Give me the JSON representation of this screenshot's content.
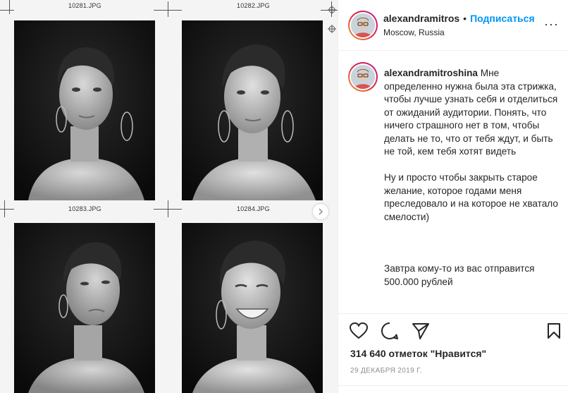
{
  "media": {
    "filenames": [
      "10281.JPG",
      "10282.JPG",
      "10283.JPG",
      "10284.JPG"
    ],
    "next_icon": "chevron-right-icon"
  },
  "post": {
    "header": {
      "username": "alexandramitros",
      "separator": "•",
      "follow_label": "Подписаться",
      "location": "Moscow, Russia",
      "more_icon": "more-options-icon",
      "more_glyph": "···"
    },
    "caption": {
      "username": "alexandramitroshina",
      "paragraph_1": "Мне определенно нужна была эта стрижка, чтобы лучше узнать себя и отделиться от ожиданий аудитории. Понять, что ничего страшного нет в том, чтобы делать не то, что от тебя ждут, и быть не той, кем тебя хотят видеть",
      "paragraph_2": "Ну и просто чтобы закрыть старое желание, которое годами меня преследовало и на которое не хватало смелости)",
      "paragraph_3": "Завтра кому-то из вас отправится 500.000 рублей"
    },
    "actions": {
      "icons": [
        "heart-icon",
        "comment-icon",
        "share-icon",
        "bookmark-icon"
      ]
    },
    "likes": "314 640 отметок \"Нравится\"",
    "date": "29 ДЕКАБРЯ 2019 Г."
  },
  "colors": {
    "accent": "#0095f6",
    "text": "#262626",
    "muted": "#8e8e8e",
    "border": "#efefef"
  }
}
